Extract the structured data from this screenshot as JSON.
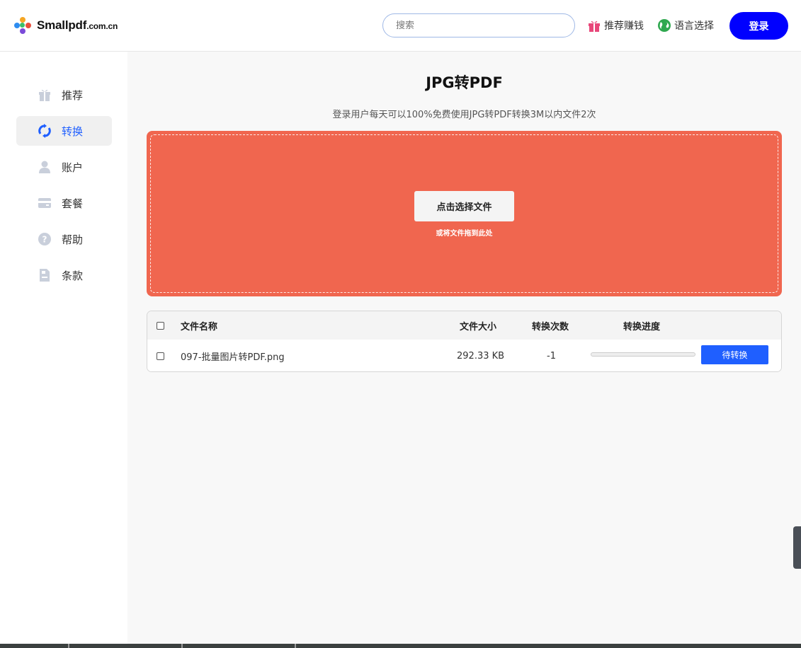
{
  "header": {
    "logo_main": "Smallpdf",
    "logo_suffix": ".com.cn",
    "search_placeholder": "搜索",
    "referral_label": "推荐赚钱",
    "language_label": "语言选择",
    "login_label": "登录"
  },
  "sidebar": {
    "items": [
      {
        "label": "推荐",
        "icon": "gift-icon"
      },
      {
        "label": "转换",
        "icon": "sync-icon",
        "active": true
      },
      {
        "label": "账户",
        "icon": "user-icon"
      },
      {
        "label": "套餐",
        "icon": "card-icon"
      },
      {
        "label": "帮助",
        "icon": "help-icon"
      },
      {
        "label": "条款",
        "icon": "document-icon"
      }
    ]
  },
  "main": {
    "title": "JPG转PDF",
    "subtitle": "登录用户每天可以100%免费使用JPG转PDF转换3M以内文件2次",
    "dropzone": {
      "button_label": "点击选择文件",
      "hint": "或将文件拖到此处"
    },
    "table": {
      "headers": {
        "name": "文件名称",
        "size": "文件大小",
        "count": "转换次数",
        "progress": "转换进度"
      },
      "rows": [
        {
          "name": "097-批量图片转PDF.png",
          "size": "292.33 KB",
          "count": "-1",
          "progress": 0,
          "status_label": "待转换"
        }
      ]
    }
  },
  "colors": {
    "accent": "#1f5fff",
    "login_button": "#0000ff",
    "dropzone": "#f0664f"
  }
}
